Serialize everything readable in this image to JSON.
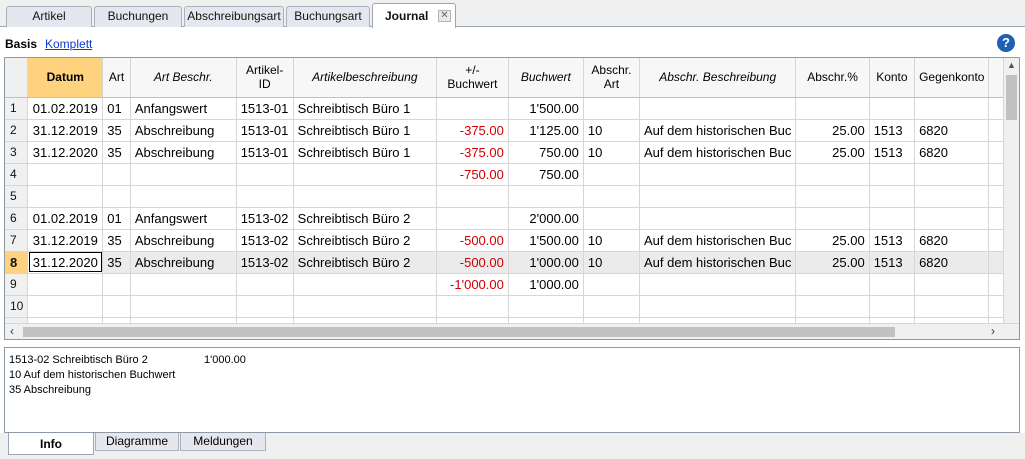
{
  "top_tabs": [
    "Artikel",
    "Buchungen",
    "Abschreibungsart",
    "Buchungsart",
    "Journal"
  ],
  "active_tab": "Journal",
  "views": {
    "basis": "Basis",
    "komplett": "Komplett"
  },
  "columns": [
    "",
    "Datum",
    "Art",
    "Art Beschr.",
    "Artikel-ID",
    "Artikelbeschreibung",
    "+/-Buchwert",
    "Buchwert",
    "Abschr. Art",
    "Abschr. Beschreibung",
    "Abschr.%",
    "Konto",
    "Gegenkonto"
  ],
  "rows": [
    [
      "1",
      "01.02.2019",
      "01",
      "Anfangswert",
      "1513-01",
      "Schreibtisch Büro 1",
      "",
      "1'500.00",
      "",
      "",
      "",
      "",
      ""
    ],
    [
      "2",
      "31.12.2019",
      "35",
      "Abschreibung",
      "1513-01",
      "Schreibtisch Büro 1",
      "-375.00",
      "1'125.00",
      "10",
      "Auf dem historischen Buc",
      "25.00",
      "1513",
      "6820"
    ],
    [
      "3",
      "31.12.2020",
      "35",
      "Abschreibung",
      "1513-01",
      "Schreibtisch Büro 1",
      "-375.00",
      "750.00",
      "10",
      "Auf dem historischen Buc",
      "25.00",
      "1513",
      "6820"
    ],
    [
      "4",
      "",
      "",
      "",
      "",
      "",
      "-750.00",
      "750.00",
      "",
      "",
      "",
      "",
      ""
    ],
    [
      "5",
      "",
      "",
      "",
      "",
      "",
      "",
      "",
      "",
      "",
      "",
      "",
      ""
    ],
    [
      "6",
      "01.02.2019",
      "01",
      "Anfangswert",
      "1513-02",
      "Schreibtisch Büro 2",
      "",
      "2'000.00",
      "",
      "",
      "",
      "",
      ""
    ],
    [
      "7",
      "31.12.2019",
      "35",
      "Abschreibung",
      "1513-02",
      "Schreibtisch Büro 2",
      "-500.00",
      "1'500.00",
      "10",
      "Auf dem historischen Buc",
      "25.00",
      "1513",
      "6820"
    ],
    [
      "8",
      "31.12.2020",
      "35",
      "Abschreibung",
      "1513-02",
      "Schreibtisch Büro 2",
      "-500.00",
      "1'000.00",
      "10",
      "Auf dem historischen Buc",
      "25.00",
      "1513",
      "6820"
    ],
    [
      "9",
      "",
      "",
      "",
      "",
      "",
      "-1'000.00",
      "1'000.00",
      "",
      "",
      "",
      "",
      ""
    ],
    [
      "10",
      "",
      "",
      "",
      "",
      "",
      "",
      "",
      "",
      "",
      "",
      "",
      ""
    ],
    [
      "",
      "",
      "",
      "",
      "",
      "",
      "",
      "",
      "",
      "",
      "",
      "",
      ""
    ]
  ],
  "current_row": "8",
  "info": {
    "line1": "1513-02 Schreibtisch Büro 2",
    "line1_value": "1'000.00",
    "line2": "10 Auf dem historischen Buchwert",
    "line3": "35 Abschreibung"
  },
  "bottom_tabs": [
    "Info",
    "Diagramme",
    "Meldungen"
  ],
  "active_bottom_tab": "Info",
  "colors": {
    "negative": "#d00000",
    "highlight": "#ffd27f",
    "link": "#0b3bd1"
  },
  "icons": {
    "help": "help-icon",
    "close": "close-icon"
  }
}
